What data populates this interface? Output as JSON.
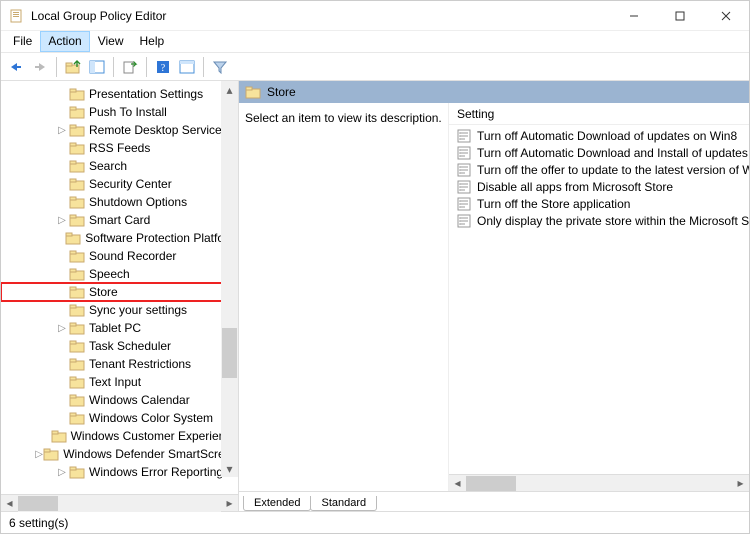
{
  "window": {
    "title": "Local Group Policy Editor"
  },
  "menu": {
    "file": "File",
    "action": "Action",
    "view": "View",
    "help": "Help"
  },
  "toolbar": {
    "back": "back",
    "forward": "forward",
    "up": "up",
    "properties": "properties",
    "refresh": "refresh",
    "help": "help",
    "show_hide": "show_hide",
    "filter": "filter"
  },
  "tree": {
    "items": [
      {
        "label": "Presentation Settings",
        "indent": 3,
        "expandable": false
      },
      {
        "label": "Push To Install",
        "indent": 3,
        "expandable": false
      },
      {
        "label": "Remote Desktop Services",
        "indent": 3,
        "expandable": true
      },
      {
        "label": "RSS Feeds",
        "indent": 3,
        "expandable": false
      },
      {
        "label": "Search",
        "indent": 3,
        "expandable": false
      },
      {
        "label": "Security Center",
        "indent": 3,
        "expandable": false
      },
      {
        "label": "Shutdown Options",
        "indent": 3,
        "expandable": false
      },
      {
        "label": "Smart Card",
        "indent": 3,
        "expandable": true
      },
      {
        "label": "Software Protection Platform",
        "indent": 3,
        "expandable": false
      },
      {
        "label": "Sound Recorder",
        "indent": 3,
        "expandable": false
      },
      {
        "label": "Speech",
        "indent": 3,
        "expandable": false
      },
      {
        "label": "Store",
        "indent": 3,
        "expandable": false,
        "highlight": true
      },
      {
        "label": "Sync your settings",
        "indent": 3,
        "expandable": false
      },
      {
        "label": "Tablet PC",
        "indent": 3,
        "expandable": true
      },
      {
        "label": "Task Scheduler",
        "indent": 3,
        "expandable": false
      },
      {
        "label": "Tenant Restrictions",
        "indent": 3,
        "expandable": false
      },
      {
        "label": "Text Input",
        "indent": 3,
        "expandable": false
      },
      {
        "label": "Windows Calendar",
        "indent": 3,
        "expandable": false
      },
      {
        "label": "Windows Color System",
        "indent": 3,
        "expandable": false
      },
      {
        "label": "Windows Customer Experience",
        "indent": 3,
        "expandable": false
      },
      {
        "label": "Windows Defender SmartScreen",
        "indent": 3,
        "expandable": true
      },
      {
        "label": "Windows Error Reporting",
        "indent": 3,
        "expandable": true
      }
    ]
  },
  "right": {
    "header": "Store",
    "description_prompt": "Select an item to view its description.",
    "column_header": "Setting",
    "settings": [
      "Turn off Automatic Download of updates on Win8",
      "Turn off Automatic Download and Install of updates",
      "Turn off the offer to update to the latest version of Windows",
      "Disable all apps from Microsoft Store",
      "Turn off the Store application",
      "Only display the private store within the Microsoft Store"
    ],
    "tabs": {
      "extended": "Extended",
      "standard": "Standard"
    }
  },
  "status": {
    "text": "6 setting(s)"
  }
}
